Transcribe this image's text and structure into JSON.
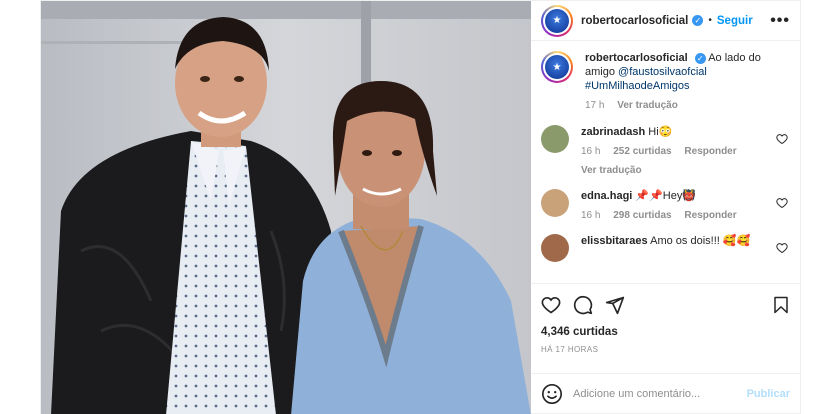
{
  "header": {
    "username": "robertocarlosoficial",
    "separator": "•",
    "follow_label": "Seguir",
    "more_label": "•••"
  },
  "caption": {
    "username": "robertocarlosoficial",
    "text": "Ao lado do amigo",
    "mention": "@faustosilvaofcial",
    "hashtag": "#UmMilhaodeAmigos",
    "time": "17 h",
    "translate_label": "Ver tradução"
  },
  "comments": [
    {
      "username": "zabrinadash",
      "text": "Hi😳",
      "time": "16 h",
      "likes": "252 curtidas",
      "reply_label": "Responder",
      "translate_label": "Ver tradução",
      "avatar_color": "#8a9a6a"
    },
    {
      "username": "edna.hagi",
      "text": "📌📌Hey👹",
      "time": "16 h",
      "likes": "298 curtidas",
      "reply_label": "Responder",
      "avatar_color": "#c9a27a"
    },
    {
      "username": "elissbitaraes",
      "text": "Amo os dois!!! 🥰🥰",
      "avatar_color": "#a06a4a"
    }
  ],
  "actions": {
    "likes": "4,346 curtidas",
    "time": "HÁ 17 HORAS"
  },
  "add_comment": {
    "placeholder": "Adicione um comentário...",
    "publish_label": "Publicar"
  },
  "colors": {
    "follow": "#0095f6",
    "verified": "#3897f0",
    "publish_disabled": "#b2dffc"
  }
}
